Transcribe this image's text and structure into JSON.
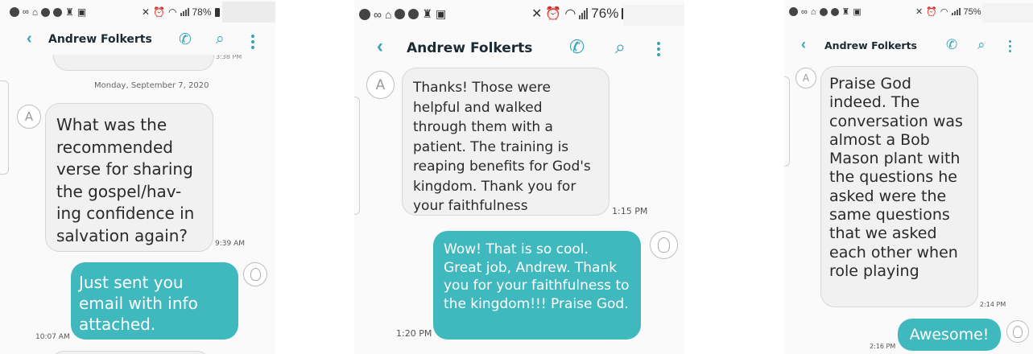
{
  "accent_color": "#37a3b6",
  "bubble_out_color": "#3fb8be",
  "screens": [
    {
      "battery": "78%",
      "contact_name": "Andrew Folkerts",
      "partial_time": "3:38 PM",
      "date_separator": "Monday, September 7, 2020",
      "avatar_letter": "A",
      "incoming_text": "What was the recommended verse for sharing the gospel/hav-ing confidence in salvation again?",
      "incoming_time": "9:39 AM",
      "outgoing_text": "Just sent you email with info attached.",
      "outgoing_time": "10:07 AM"
    },
    {
      "battery": "76%",
      "contact_name": "Andrew Folkerts",
      "avatar_letter": "A",
      "incoming_text": "Thanks! Those were helpful and walked through them with a patient. The training is reaping benefits for God's kingdom. Thank you for your faithfulness",
      "incoming_time": "1:15 PM",
      "outgoing_text": "Wow! That is so cool. Great job, Andrew. Thank you for your faithfulness to the kingdom!!! Praise God.",
      "outgoing_time": "1:20 PM"
    },
    {
      "battery": "75%",
      "contact_name": "Andrew Folkerts",
      "avatar_letter": "A",
      "incoming_text": "Praise God indeed. The conversation was almost a Bob Mason plant with the questions he asked were the same questions that we asked each other when role playing",
      "incoming_time": "2:14 PM",
      "outgoing_text": "Awesome!",
      "outgoing_time": "2:16 PM"
    }
  ]
}
